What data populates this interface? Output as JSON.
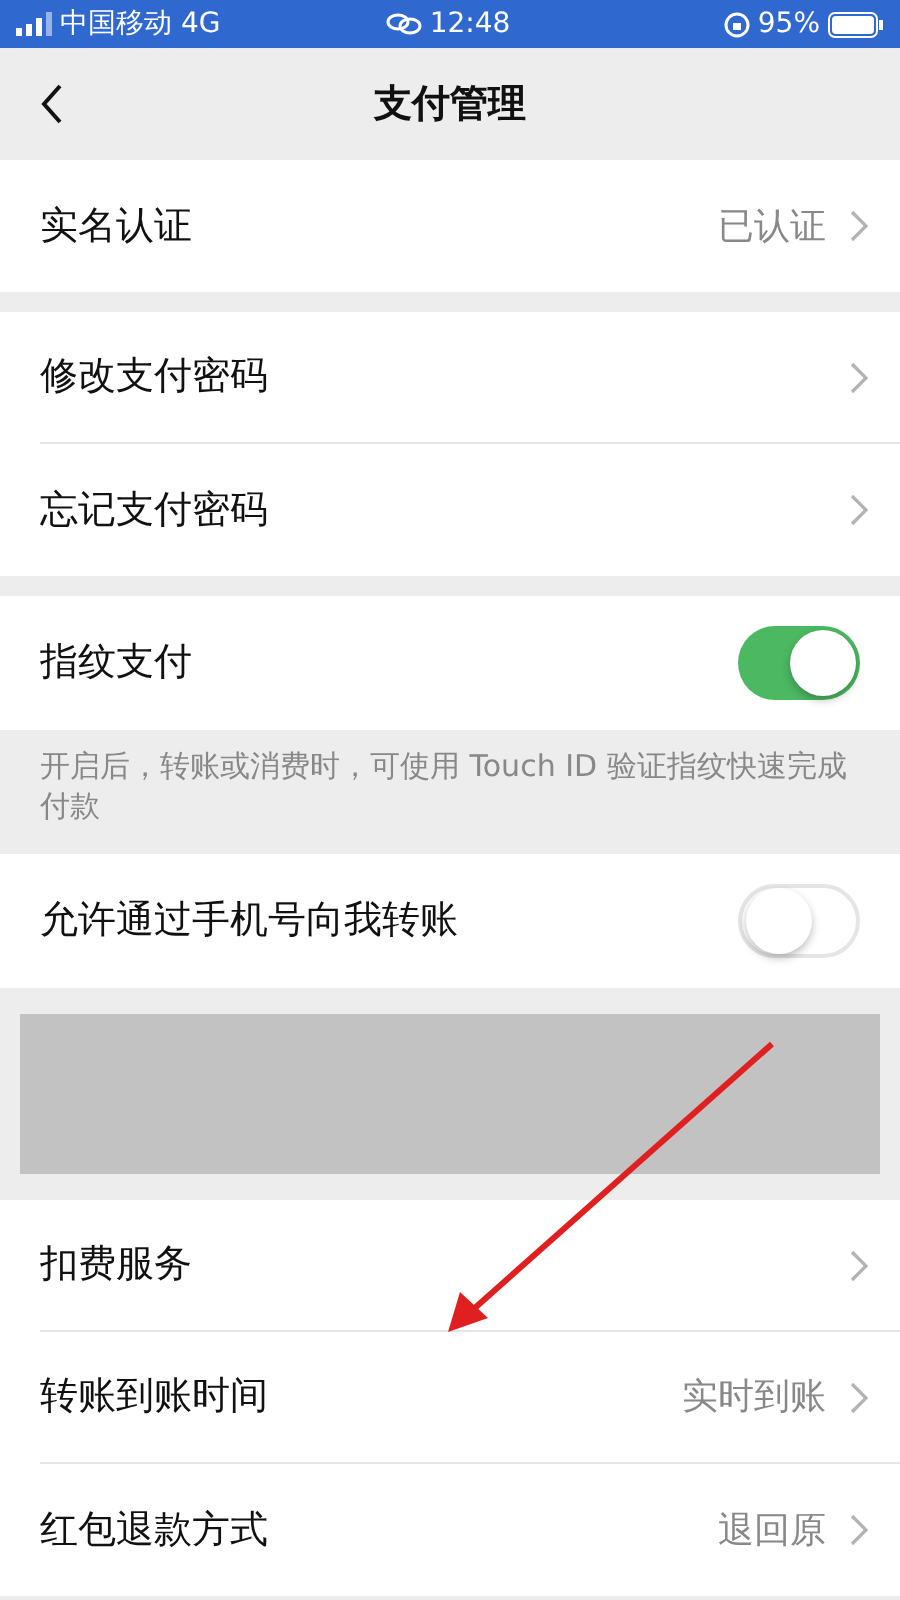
{
  "status_bar": {
    "carrier": "中国移动 4G",
    "time": "12:48",
    "battery": "95%"
  },
  "nav": {
    "title": "支付管理"
  },
  "sections": [
    {
      "rows": [
        {
          "kind": "link",
          "label": "实名认证",
          "value": "已认证"
        }
      ]
    },
    {
      "rows": [
        {
          "kind": "link",
          "label": "修改支付密码"
        },
        {
          "kind": "link",
          "label": "忘记支付密码"
        }
      ]
    },
    {
      "rows": [
        {
          "kind": "toggle",
          "label": "指纹支付",
          "on": true
        }
      ],
      "note": "开启后，转账或消费时，可使用 Touch ID 验证指纹快速完成付款"
    },
    {
      "rows": [
        {
          "kind": "toggle",
          "label": "允许通过手机号向我转账",
          "on": false
        }
      ]
    },
    {
      "rows": [
        {
          "kind": "redacted"
        }
      ]
    },
    {
      "rows": [
        {
          "kind": "link",
          "label": "扣费服务"
        },
        {
          "kind": "link",
          "label": "转账到账时间",
          "value": "实时到账"
        },
        {
          "kind": "link",
          "label": "红包退款方式",
          "value": "退回原"
        }
      ]
    }
  ]
}
